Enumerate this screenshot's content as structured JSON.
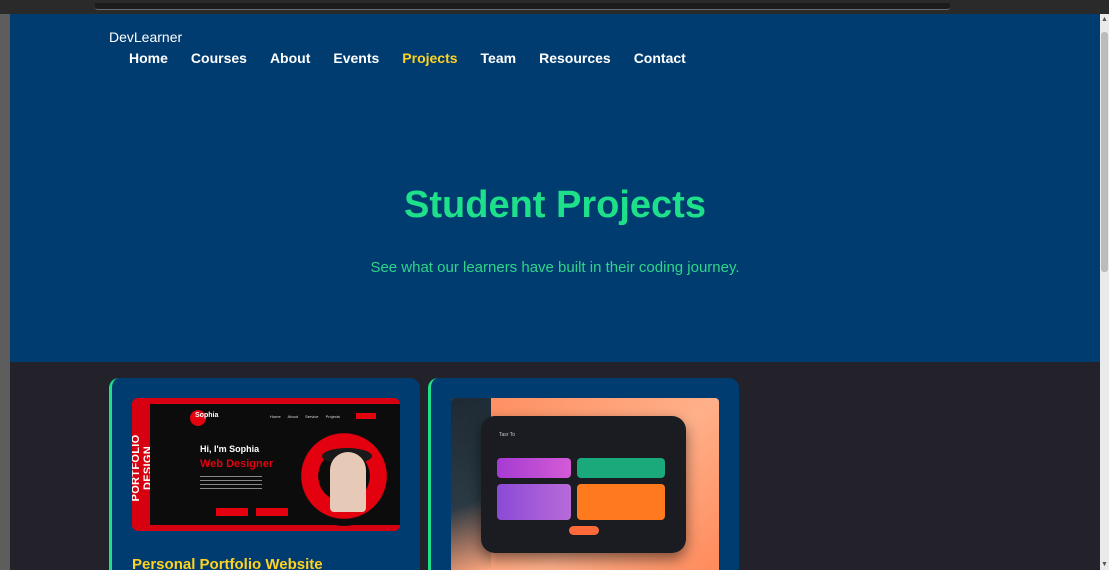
{
  "brand": "DevLearner",
  "nav": {
    "items": [
      {
        "label": "Home"
      },
      {
        "label": "Courses"
      },
      {
        "label": "About"
      },
      {
        "label": "Events"
      },
      {
        "label": "Projects",
        "active": true
      },
      {
        "label": "Team"
      },
      {
        "label": "Resources"
      },
      {
        "label": "Contact"
      }
    ]
  },
  "hero": {
    "title": "Student Projects",
    "subtitle": "See what our learners have built in their coding journey."
  },
  "projects": [
    {
      "title": "Personal Portfolio Website",
      "thumbnail": {
        "side_text": "PORTFOLIO DESIGN",
        "logo": "Sophia",
        "greeting": "Hi, I'm Sophia",
        "role": "Web Designer"
      }
    },
    {
      "title": "",
      "thumbnail": {
        "app_title": "Tasr To"
      }
    }
  ],
  "colors": {
    "hero_bg": "#003c70",
    "accent_green": "#1ee08a",
    "active_yellow": "#ffd21f",
    "page_bg": "#23212a"
  }
}
